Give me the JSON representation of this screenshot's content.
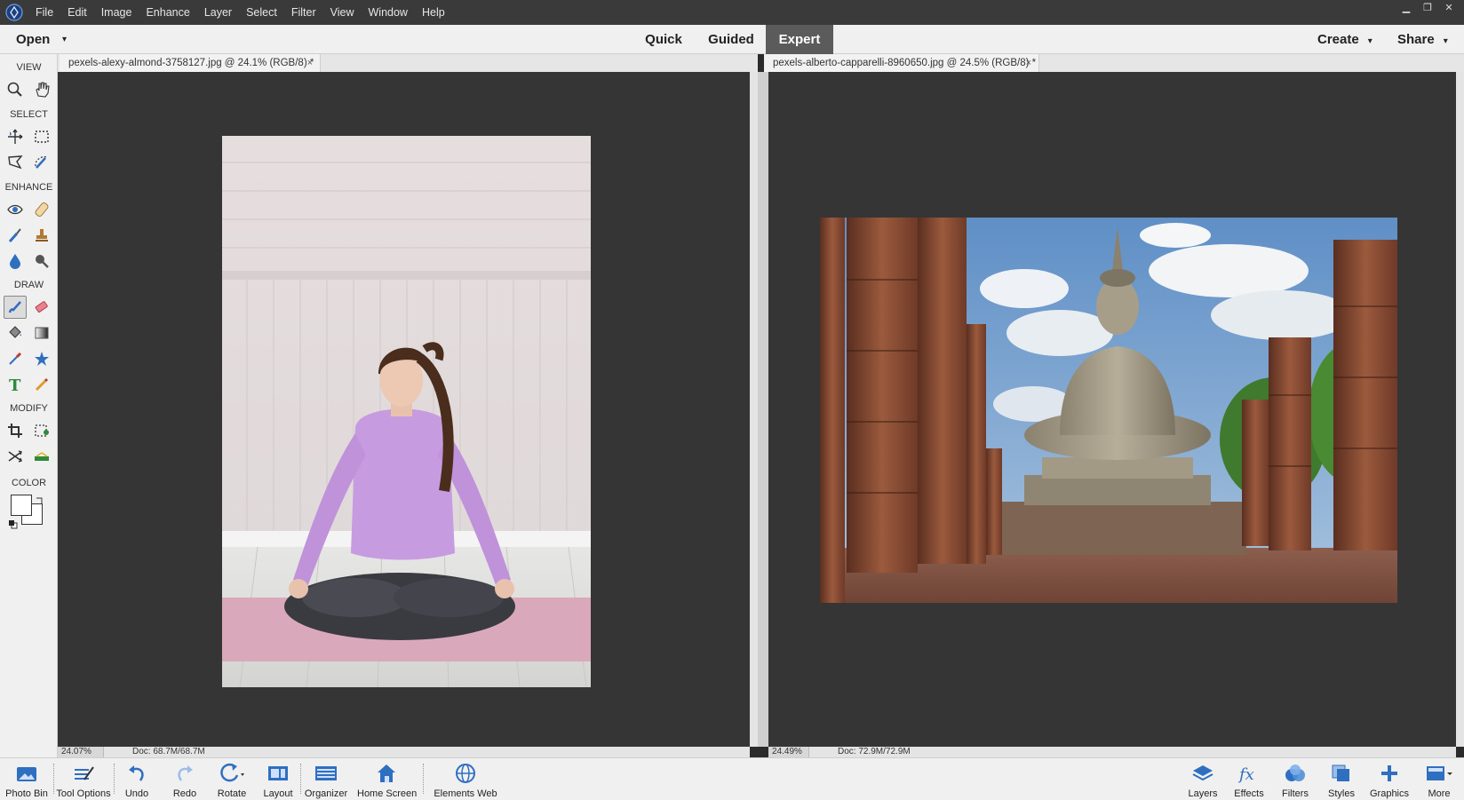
{
  "menu": [
    "File",
    "Edit",
    "Image",
    "Enhance",
    "Layer",
    "Select",
    "Filter",
    "View",
    "Window",
    "Help"
  ],
  "window_controls": {
    "minimize": "▁",
    "restore": "❐",
    "close": "✕"
  },
  "modebar": {
    "open_label": "Open",
    "open_caret": "▾",
    "modes": [
      "Quick",
      "Guided",
      "Expert"
    ],
    "active_mode": "Expert",
    "create_label": "Create",
    "share_label": "Share",
    "caret": "▾"
  },
  "toolbox": {
    "sections": [
      "VIEW",
      "SELECT",
      "ENHANCE",
      "DRAW",
      "MODIFY",
      "COLOR"
    ]
  },
  "documents": [
    {
      "tab_label": "pexels-alexy-almond-3758127.jpg @ 24.1% (RGB/8) *",
      "close": "×",
      "zoom": "24.07%",
      "doc_size": "Doc: 68.7M/68.7M"
    },
    {
      "tab_label": "pexels-alberto-capparelli-8960650.jpg @ 24.5% (RGB/8) *",
      "close": "×",
      "zoom": "24.49%",
      "doc_size": "Doc: 72.9M/72.9M"
    }
  ],
  "bottombar": {
    "left": [
      "Photo Bin",
      "Tool Options",
      "Undo",
      "Redo",
      "Rotate",
      "Layout",
      "Organizer",
      "Home Screen",
      "Elements Web"
    ],
    "right": [
      "Layers",
      "Effects",
      "Filters",
      "Styles",
      "Graphics",
      "More"
    ]
  },
  "colors": {
    "accent_blue": "#2f6fc0",
    "canvas_bg": "#353535",
    "panel_bg": "#f0f0f0",
    "menubar_bg": "#3a3a3a",
    "active_mode_bg": "#5b5b5b"
  }
}
